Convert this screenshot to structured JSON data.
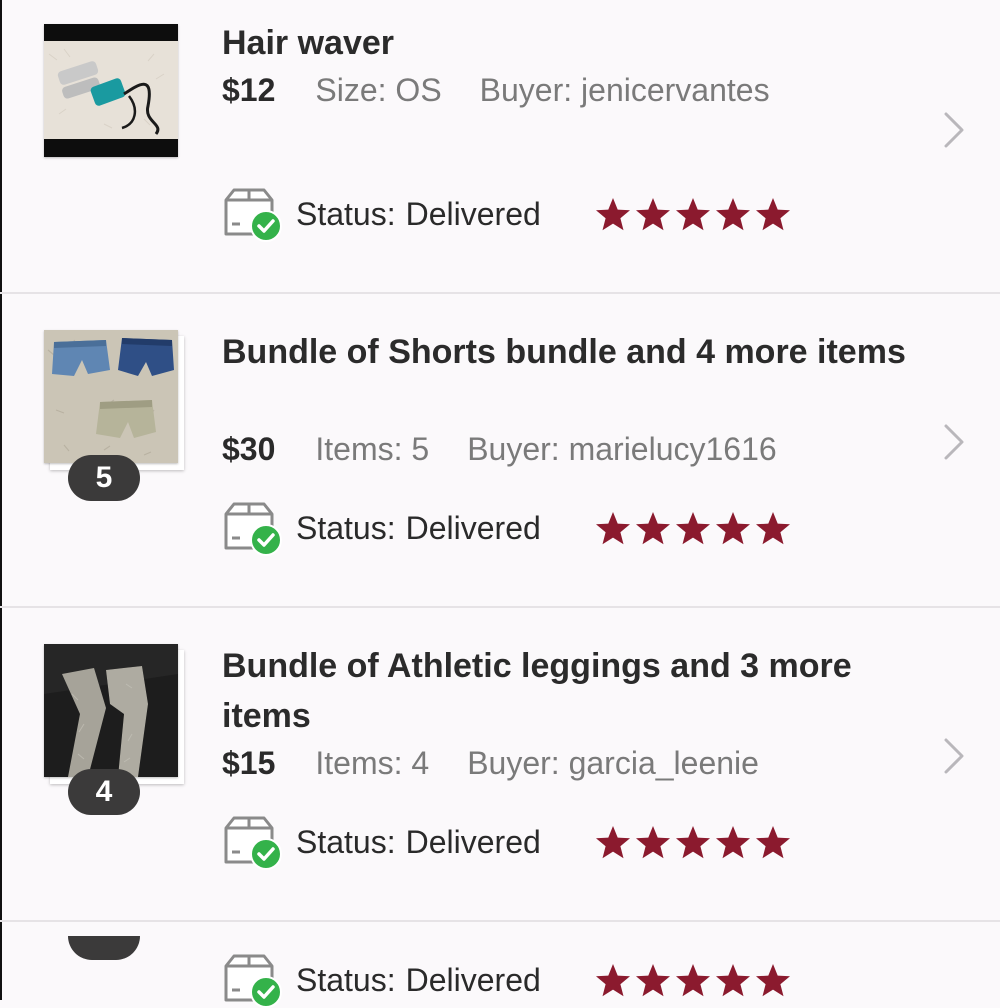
{
  "orders": [
    {
      "title": "Hair waver",
      "price": "$12",
      "detail": "Size: OS",
      "buyer": "Buyer: jenicervantes",
      "status_label": "Status:",
      "status_value": "Delivered",
      "rating": 5,
      "item_count": null
    },
    {
      "title": "Bundle of Shorts bundle and 4 more items",
      "price": "$30",
      "detail": "Items: 5",
      "buyer": "Buyer: marielucy1616",
      "status_label": "Status:",
      "status_value": "Delivered",
      "rating": 5,
      "item_count": "5"
    },
    {
      "title": "Bundle of Athletic leggings and 3 more items",
      "price": "$15",
      "detail": "Items: 4",
      "buyer": "Buyer: garcia_leenie",
      "status_label": "Status:",
      "status_value": "Delivered",
      "rating": 5,
      "item_count": "4"
    },
    {
      "status_label": "Status:",
      "status_value": "Delivered",
      "rating": 5
    }
  ],
  "colors": {
    "star": "#8b1a2e",
    "check": "#34b24a",
    "divider": "#e6e3e6",
    "muted_text": "#7a7a7a"
  },
  "icons": {
    "status": "package-delivered-icon",
    "rating": "star-icon",
    "open": "chevron-right-icon"
  }
}
